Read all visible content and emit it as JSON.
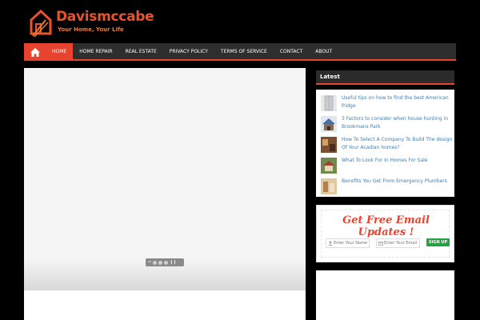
{
  "header": {
    "site_title": "Davismccabe",
    "tagline": "Your Home, Your Life",
    "accent_color": "#e8532e"
  },
  "nav": {
    "home_icon": "home-icon",
    "items": [
      {
        "label": "HOME",
        "active": true
      },
      {
        "label": "HOME REPAIR"
      },
      {
        "label": "REAL ESTATE"
      },
      {
        "label": "PRIVACY POLICY"
      },
      {
        "label": "TERMS OF SERVICE"
      },
      {
        "label": "CONTACT"
      },
      {
        "label": "ABOUT"
      }
    ]
  },
  "slider": {
    "controls": "prev/next"
  },
  "latest": {
    "title": "Latest",
    "posts": [
      {
        "title": "Useful tips on how to find the best American fridge"
      },
      {
        "title": "3 Factors to consider when house hunting in Brookmans Park"
      },
      {
        "title": "How To Select A Company To Build The design Of Your Acadian homes?"
      },
      {
        "title": "What To Look For In Homes For Sale"
      },
      {
        "title": "Benefits You Get From Emergency Plumbers"
      }
    ]
  },
  "email": {
    "title": "Get Free Email Updates !",
    "name_placeholder": "Enter Your Name",
    "email_placeholder": "Enter Your Email",
    "signup_label": "SIGN UP",
    "button_color": "#25a244"
  }
}
